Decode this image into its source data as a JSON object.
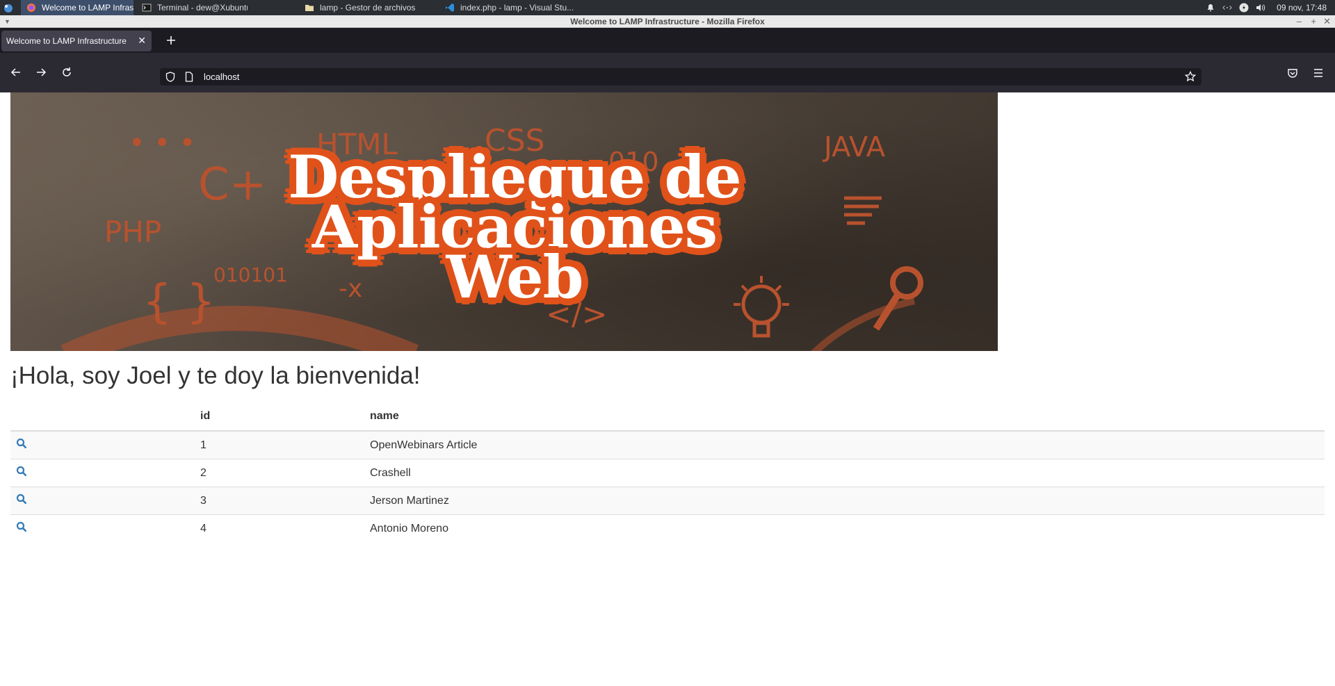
{
  "panel": {
    "tasks": [
      {
        "label": "Welcome to LAMP Infrastru...",
        "icon": "firefox-icon",
        "active": true
      },
      {
        "label": "Terminal - dew@XubuntuDE...",
        "icon": "terminal-icon",
        "active": false
      },
      {
        "label": "lamp - Gestor de archivos",
        "icon": "folder-icon",
        "active": false
      },
      {
        "label": "index.php - lamp - Visual Stu...",
        "icon": "vscode-icon",
        "active": false
      }
    ],
    "clock": "09 nov, 17:48"
  },
  "window": {
    "title": "Welcome to LAMP Infrastructure - Mozilla Firefox"
  },
  "browser": {
    "tab_title": "Welcome to LAMP Infrastructure",
    "url": "localhost"
  },
  "banner": {
    "title_lines": [
      "Despliegue de",
      "Aplicaciones",
      "Web"
    ],
    "decorations": [
      "HTML",
      "CSS",
      "JAVA",
      "PHP",
      "C+",
      "010101",
      "{ }",
      "</>",
      "-x",
      "010"
    ]
  },
  "page": {
    "welcome": "¡Hola, soy Joel y te doy la bienvenida!",
    "table": {
      "headers": [
        "",
        "id",
        "name"
      ],
      "rows": [
        {
          "id": "1",
          "name": "OpenWebinars Article"
        },
        {
          "id": "2",
          "name": "Crashell"
        },
        {
          "id": "3",
          "name": "Jerson Martinez"
        },
        {
          "id": "4",
          "name": "Antonio Moreno"
        }
      ]
    }
  },
  "colors": {
    "accent_link": "#337ab7",
    "banner_orange": "#e0521a",
    "panel_active": "#3d4f6b"
  }
}
